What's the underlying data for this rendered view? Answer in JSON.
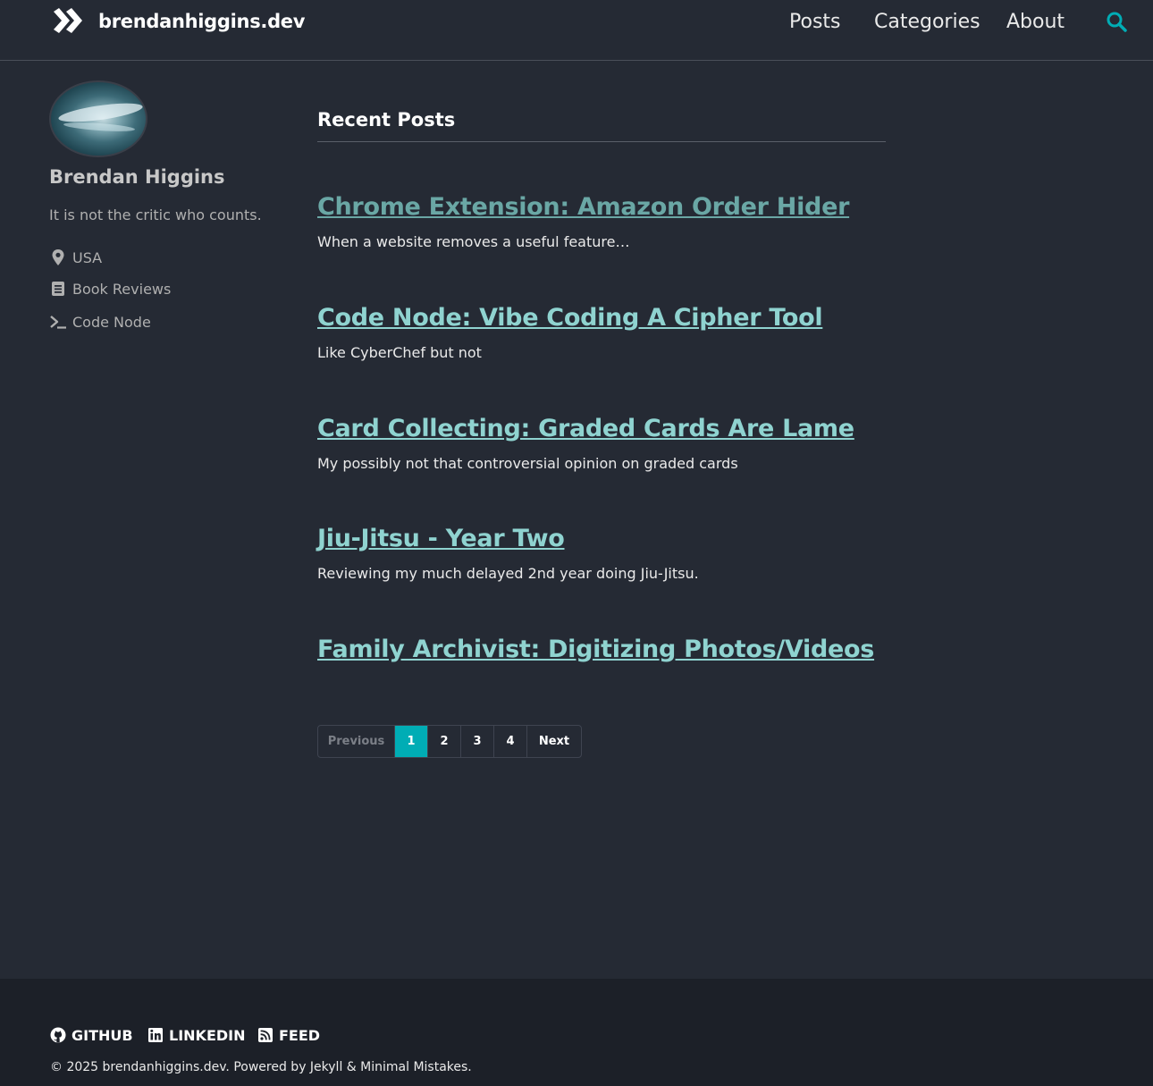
{
  "header": {
    "site_title": "brendanhiggins.dev",
    "nav": [
      {
        "label": "Posts"
      },
      {
        "label": "Categories"
      },
      {
        "label": "About"
      }
    ],
    "search_icon": "search-icon",
    "accent_color": "#00adb5"
  },
  "sidebar": {
    "author_name": "Brendan Higgins",
    "bio": "It is not the critic who counts.",
    "links": [
      {
        "icon": "map-marker-icon",
        "label": "USA"
      },
      {
        "icon": "book-icon",
        "label": "Book Reviews"
      },
      {
        "icon": "terminal-icon",
        "label": "Code Node"
      }
    ]
  },
  "main": {
    "section_title": "Recent Posts",
    "posts": [
      {
        "title": "Chrome Extension: Amazon Order Hider",
        "excerpt": "When a website removes a useful feature…"
      },
      {
        "title": "Code Node: Vibe Coding A Cipher Tool",
        "excerpt": "Like CyberChef but not"
      },
      {
        "title": "Card Collecting: Graded Cards Are Lame",
        "excerpt": "My possibly not that controversial opinion on graded cards"
      },
      {
        "title": "Jiu-Jitsu - Year Two",
        "excerpt": "Reviewing my much delayed 2nd year doing Jiu-Jitsu."
      },
      {
        "title": "Family Archivist: Digitizing Photos/Videos",
        "excerpt": ""
      }
    ],
    "pagination": {
      "previous": "Previous",
      "pages": [
        "1",
        "2",
        "3",
        "4"
      ],
      "current": "1",
      "next": "Next"
    }
  },
  "footer": {
    "links": [
      {
        "icon": "github-icon",
        "label": "GITHUB"
      },
      {
        "icon": "linkedin-icon",
        "label": "LINKEDIN"
      },
      {
        "icon": "rss-icon",
        "label": "FEED"
      }
    ],
    "copyright": "© 2025 brendanhiggins.dev. Powered by Jekyll & Minimal Mistakes."
  }
}
